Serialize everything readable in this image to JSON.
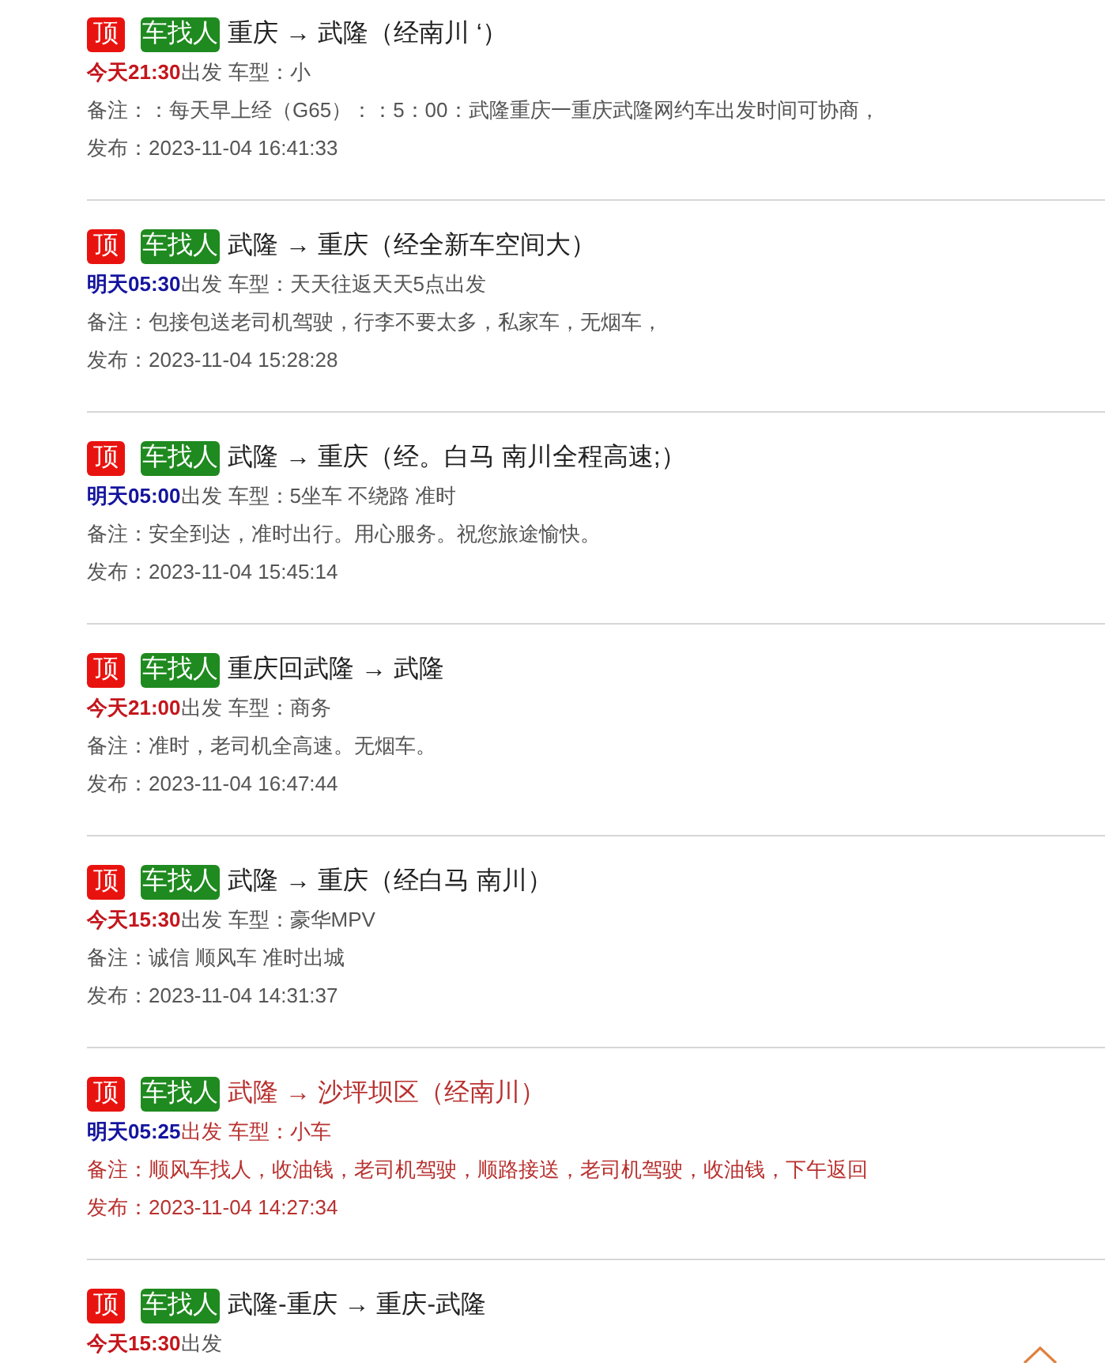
{
  "listings": [
    {
      "top_badge": "顶",
      "type_badge": "车找人",
      "route": "重庆 → 武隆（经南川 ‘）",
      "highlighted": false,
      "departure": {
        "kind": "today",
        "time": "今天21:30",
        "label": "出发"
      },
      "car_type": "车型：小",
      "remark": "备注：：每天早上经（G65）：：5：00：武隆重庆一重庆武隆网约车出发时间可协商，",
      "published": "发布：2023-11-04 16:41:33"
    },
    {
      "top_badge": "顶",
      "type_badge": "车找人",
      "route": "武隆 → 重庆（经全新车空间大）",
      "highlighted": false,
      "departure": {
        "kind": "tomorrow",
        "time": "明天05:30",
        "label": "出发"
      },
      "car_type": "车型：天天往返天天5点出发",
      "remark": "备注：包接包送老司机驾驶，行李不要太多，私家车，无烟车，",
      "published": "发布：2023-11-04 15:28:28"
    },
    {
      "top_badge": "顶",
      "type_badge": "车找人",
      "route": "武隆 → 重庆（经。白马 南川全程高速;）",
      "highlighted": false,
      "departure": {
        "kind": "tomorrow",
        "time": "明天05:00",
        "label": "出发"
      },
      "car_type": "车型：5坐车 不绕路 准时",
      "remark": "备注：安全到达，准时出行。用心服务。祝您旅途愉快。",
      "published": "发布：2023-11-04 15:45:14"
    },
    {
      "top_badge": "顶",
      "type_badge": "车找人",
      "route": "重庆回武隆 → 武隆",
      "highlighted": false,
      "departure": {
        "kind": "today",
        "time": "今天21:00",
        "label": "出发"
      },
      "car_type": "车型：商务",
      "remark": "备注：准时，老司机全高速。无烟车。",
      "published": "发布：2023-11-04 16:47:44"
    },
    {
      "top_badge": "顶",
      "type_badge": "车找人",
      "route": "武隆 → 重庆（经白马 南川）",
      "highlighted": false,
      "departure": {
        "kind": "today",
        "time": "今天15:30",
        "label": "出发"
      },
      "car_type": "车型：豪华MPV",
      "remark": "备注：诚信 顺风车 准时出城",
      "published": "发布：2023-11-04 14:31:37"
    },
    {
      "top_badge": "顶",
      "type_badge": "车找人",
      "route": "武隆 → 沙坪坝区（经南川）",
      "highlighted": true,
      "departure": {
        "kind": "tomorrow",
        "time": "明天05:25",
        "label": "出发"
      },
      "car_type": "车型：小车",
      "remark": "备注：顺风车找人，收油钱，老司机驾驶，顺路接送，老司机驾驶，收油钱，下午返回",
      "published": "发布：2023-11-04 14:27:34"
    },
    {
      "top_badge": "顶",
      "type_badge": "车找人",
      "route": "武隆-重庆 → 重庆-武隆",
      "highlighted": false,
      "departure": {
        "kind": "today",
        "time": "今天15:30",
        "label": "出发"
      }
    }
  ]
}
